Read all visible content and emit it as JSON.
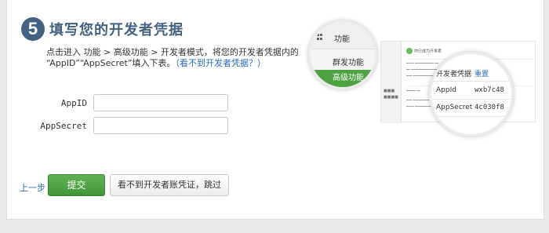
{
  "step": {
    "number": "5",
    "title": "填写您的开发者凭据"
  },
  "description": {
    "line1": "点击进入 功能 > 高级功能 > 开发者模式，将您的开发者凭据内的",
    "line2": "“AppID”“AppSecret”填入下表。",
    "help_link": "（看不到开发者凭据？）"
  },
  "form": {
    "appid_label": "AppID",
    "appid_value": "",
    "appsecret_label": "AppSecret",
    "appsecret_value": ""
  },
  "actions": {
    "prev_label": "上一步",
    "submit_label": "提交",
    "skip_label": "看不到开发者账凭证，跳过"
  },
  "illustration": {
    "menu_header": "功能",
    "menu_item": "群发功能",
    "menu_item_active": "高级功能",
    "credentials_title": "开发者凭据",
    "reset_label": "重置",
    "appid_key": "AppId",
    "appid_partial": "wxb7c48",
    "appsecret_key": "AppSecret",
    "appsecret_partial": "4c030f8",
    "success_text": "你已成为开发者"
  },
  "colors": {
    "title_blue": "#44617f",
    "link_blue": "#2a6ab8",
    "submit_green": "#4ea244"
  }
}
